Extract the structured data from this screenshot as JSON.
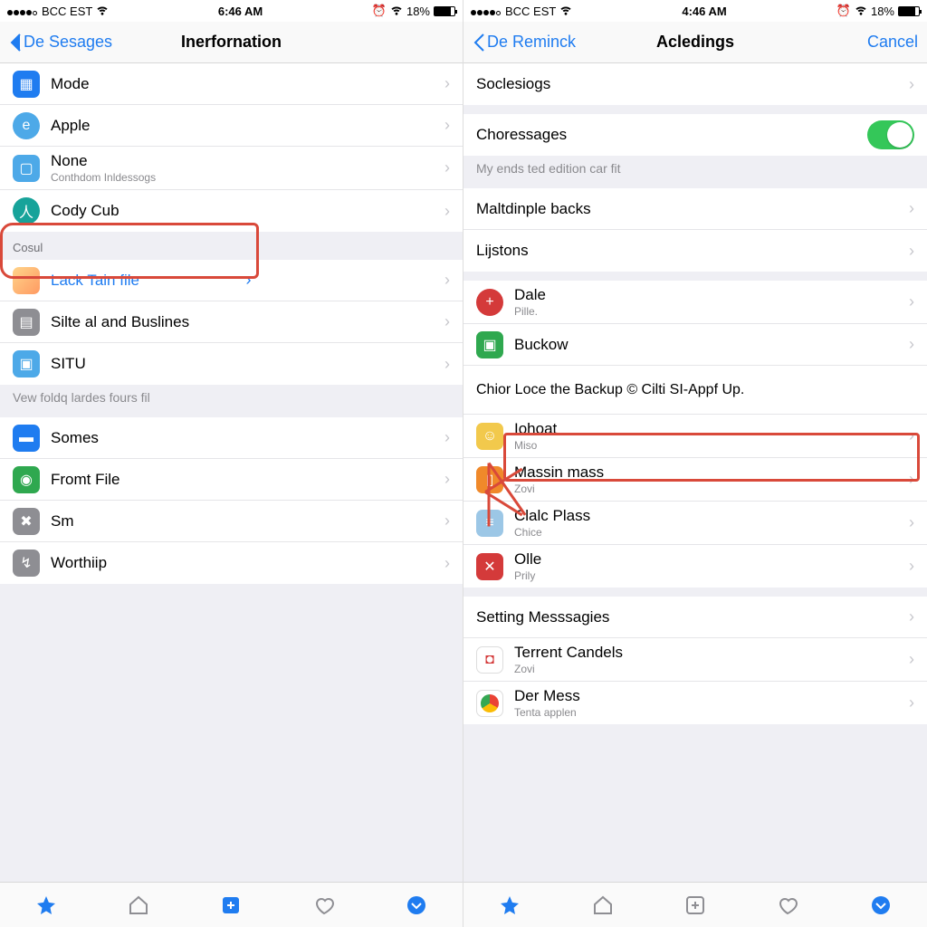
{
  "left": {
    "status": {
      "carrier": "BCC  EST",
      "time": "6:46 AM",
      "battery": "18%"
    },
    "nav": {
      "back": "De Sesages",
      "title": "Inerfornation"
    },
    "rows1": [
      {
        "icon": "calendar-icon",
        "title": "Mode"
      },
      {
        "icon": "edge-icon",
        "title": "Apple"
      },
      {
        "icon": "bag-icon",
        "title": "None",
        "sub": "Conthdom Inldessogs"
      },
      {
        "icon": "person-icon",
        "title": "Cody Cub"
      }
    ],
    "section2_header": "Cosul",
    "rows2": [
      {
        "icon": "photo-icon",
        "title": "Lack Tain file",
        "link": true,
        "inner_chev": "›"
      },
      {
        "icon": "grid-icon",
        "title": "Silte al and Buslines"
      },
      {
        "icon": "app-icon",
        "title": "SITU"
      }
    ],
    "footer_note": "Vew foldq lardes fours fil",
    "rows3": [
      {
        "icon": "folder-icon",
        "title": "Somes"
      },
      {
        "icon": "whats-icon",
        "title": "Fromt File"
      },
      {
        "icon": "wrench-icon",
        "title": "Sm"
      },
      {
        "icon": "key-icon",
        "title": "Worthiip"
      }
    ]
  },
  "right": {
    "status": {
      "carrier": "BCC  EST",
      "time": "4:46 AM",
      "battery": "18%"
    },
    "nav": {
      "back": "De Reminck",
      "title": "Acledings",
      "action": "Cancel"
    },
    "rows1": [
      {
        "title": "Soclesiogs"
      }
    ],
    "toggle": {
      "title": "Choressages",
      "on": true
    },
    "toggle_note": "My ends ted edition car fit",
    "rows2": [
      {
        "title": "Maltdinple backs"
      },
      {
        "title": "Lijstons"
      }
    ],
    "apps": [
      {
        "icon": "plus-icon",
        "title": "Dale",
        "sub": "Pille."
      },
      {
        "icon": "green-app-icon",
        "title": "Buckow"
      }
    ],
    "callout_text": "Chior Loce the Backup © Cilti SI-Appf Up.",
    "apps2": [
      {
        "icon": "game-icon",
        "title": "Iohoat",
        "sub": "Miso"
      },
      {
        "icon": "trash-icon",
        "title": "Massin mass",
        "sub": "Zovi"
      },
      {
        "icon": "list-icon",
        "title": "Clalc Plass",
        "sub": "Chice"
      },
      {
        "icon": "x-icon",
        "title": "Olle",
        "sub": "Prily"
      }
    ],
    "section3_header": "Setting Messsagies",
    "apps3": [
      {
        "icon": "dot-icon",
        "title": "Terrent Candels",
        "sub": "Zovi"
      },
      {
        "icon": "chrome-icon",
        "title": "Der Mess",
        "sub": "Tenta applen"
      }
    ]
  },
  "chevron": "›",
  "tabbar": [
    "star",
    "home",
    "plus",
    "heart",
    "check"
  ]
}
